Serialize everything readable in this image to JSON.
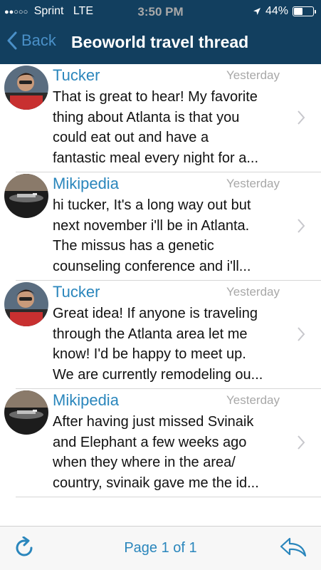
{
  "status_bar": {
    "carrier": "Sprint",
    "network": "LTE",
    "time": "3:50 PM",
    "battery": "44%",
    "battery_level": 0.44,
    "signal_bars": 2,
    "signal_total": 5
  },
  "nav": {
    "back_label": "Back",
    "title": "Beoworld travel thread"
  },
  "posts": [
    {
      "author": "Tucker",
      "time": "Yesterday",
      "lines": [
        "That is great to hear!  My favorite",
        "thing about Atlanta is that you",
        "could eat out and have a",
        "fantastic meal every night for a..."
      ]
    },
    {
      "author": "Mikipedia",
      "time": "Yesterday",
      "lines": [
        "hi tucker, It's a long way out but",
        "next november i'll be in Atlanta.",
        "The missus has a genetic",
        "counseling conference and i'll..."
      ]
    },
    {
      "author": "Tucker",
      "time": "Yesterday",
      "lines": [
        "Great idea!  If anyone is traveling",
        "through the Atlanta area let me",
        "know! I'd be happy to meet up.",
        "We are currently remodeling ou..."
      ]
    },
    {
      "author": "Mikipedia",
      "time": "Yesterday",
      "lines": [
        "After having just missed Svinaik",
        "and Elephant a few weeks ago",
        "when they where in the area/",
        "country, svinaik gave me the id..."
      ]
    }
  ],
  "toolbar": {
    "page_label": "Page 1 of 1",
    "refresh_icon": "refresh-icon",
    "reply_icon": "reply-icon"
  },
  "colors": {
    "nav_background": "#123f5f",
    "accent": "#2a86bc",
    "timestamp": "#a8a8a8"
  }
}
